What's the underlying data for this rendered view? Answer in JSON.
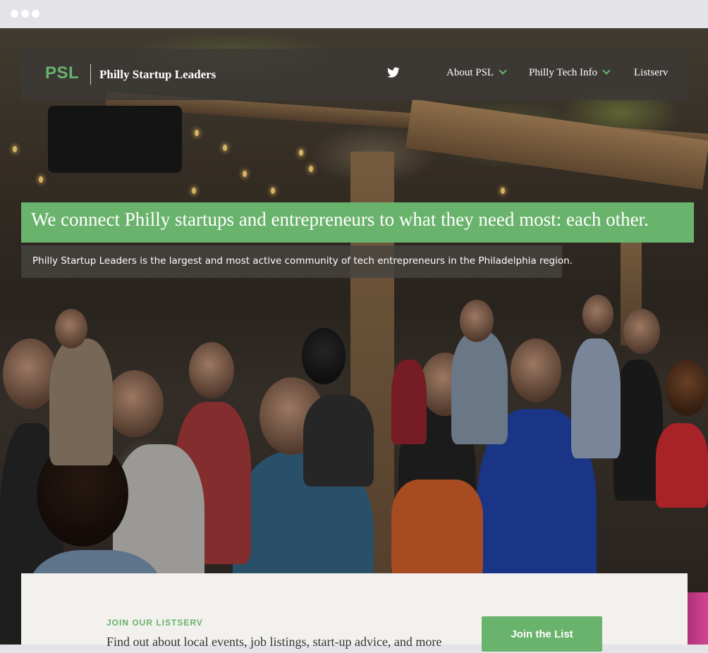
{
  "brand": {
    "logo": "PSL",
    "name": "Philly Startup Leaders"
  },
  "nav": {
    "twitter_icon": "twitter-icon",
    "items": [
      {
        "label": "About PSL",
        "has_dropdown": true
      },
      {
        "label": "Philly Tech Info",
        "has_dropdown": true
      },
      {
        "label": "Listserv",
        "has_dropdown": false
      }
    ]
  },
  "hero": {
    "headline": "We connect Philly startups and entrepreneurs to what they need most: each other.",
    "subline": "Philly Startup Leaders is the largest and most active community of tech entrepreneurs in the Philadelphia region."
  },
  "listserv": {
    "heading": "JOIN OUR LISTSERV",
    "text": "Find out about local events, job listings, start-up advice, and more",
    "button": "Join the List"
  },
  "colors": {
    "accent": "#6ab36c",
    "nav_bg": "#3c3a36",
    "panel_bg": "#f2f1ee"
  }
}
